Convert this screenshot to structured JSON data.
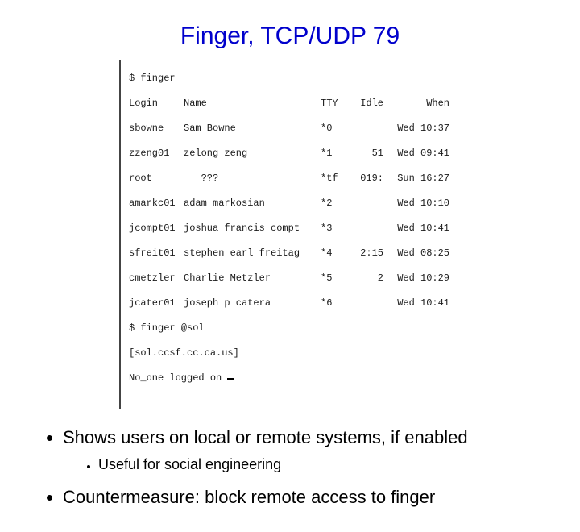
{
  "slide": {
    "title": "Finger, TCP/UDP 79"
  },
  "terminal": {
    "command1": "$ finger",
    "headers": {
      "login": "Login",
      "name": "Name",
      "tty": "TTY",
      "idle": "Idle",
      "when": "When"
    },
    "rows": [
      {
        "login": "sbowne",
        "name": "Sam Bowne",
        "tty": "*0",
        "idle": "",
        "when": "Wed 10:37"
      },
      {
        "login": "zzeng01",
        "name": "zelong zeng",
        "tty": "*1",
        "idle": "51",
        "when": "Wed 09:41"
      },
      {
        "login": "root",
        "name": "   ???",
        "tty": "*tf",
        "idle": "019:",
        "when": "Sun 16:27"
      },
      {
        "login": "amarkc01",
        "name": "adam markosian",
        "tty": "*2",
        "idle": "",
        "when": "Wed 10:10"
      },
      {
        "login": "jcompt01",
        "name": "joshua francis compt",
        "tty": "*3",
        "idle": "",
        "when": "Wed 10:41"
      },
      {
        "login": "sfreit01",
        "name": "stephen earl freitag",
        "tty": "*4",
        "idle": "2:15",
        "when": "Wed 08:25"
      },
      {
        "login": "cmetzler",
        "name": "Charlie Metzler",
        "tty": "*5",
        "idle": "2",
        "when": "Wed 10:29"
      },
      {
        "login": "jcater01",
        "name": "joseph p catera",
        "tty": "*6",
        "idle": "",
        "when": "Wed 10:41"
      }
    ],
    "command2": "$ finger @sol",
    "host_line": "[sol.ccsf.cc.ca.us]",
    "noone_line": "No_one logged on"
  },
  "bullets": {
    "b1": "Shows users on local or remote systems, if enabled",
    "b1a": "Useful for social engineering",
    "b2": "Countermeasure: block remote access to finger"
  }
}
